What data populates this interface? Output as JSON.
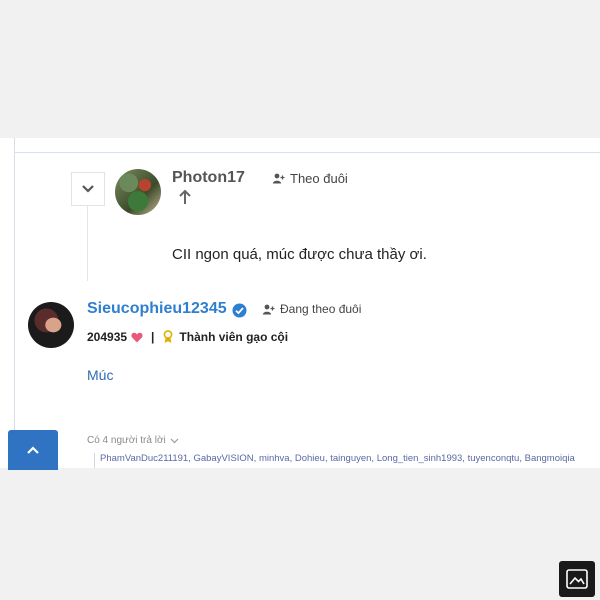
{
  "thread": {
    "parent_reply": {
      "username": "Photon17",
      "follow_label": "Theo đuôi",
      "text": "CII ngon quá, múc được chưa thầy ơi."
    },
    "reply": {
      "username": "Sieucophieu12345",
      "follow_label": "Đang theo đuôi",
      "points": "204935",
      "rank": "Thành viên gạo cội",
      "text": "Múc"
    },
    "replies_summary": {
      "label": "Có 4 người trả lời",
      "repliers": "PhamVanDuc211191, GabayVISION, minhva, Dohieu, tainguyen, Long_tien_sinh1993, tuyenconqtu, Bangmoiqia"
    }
  },
  "colors": {
    "accent": "#2f73c2",
    "username_link": "#2f7fd0",
    "heart": "#e85a7a",
    "medal": "#e0b000"
  },
  "icons": {
    "collapse": "chevron-down-icon",
    "follow": "user-follow-icon",
    "upvote": "arrow-up-icon",
    "verified": "verified-badge-icon",
    "heart": "heart-icon",
    "medal": "medal-icon",
    "scroll_top": "chevron-up-icon",
    "gallery": "image-icon"
  }
}
